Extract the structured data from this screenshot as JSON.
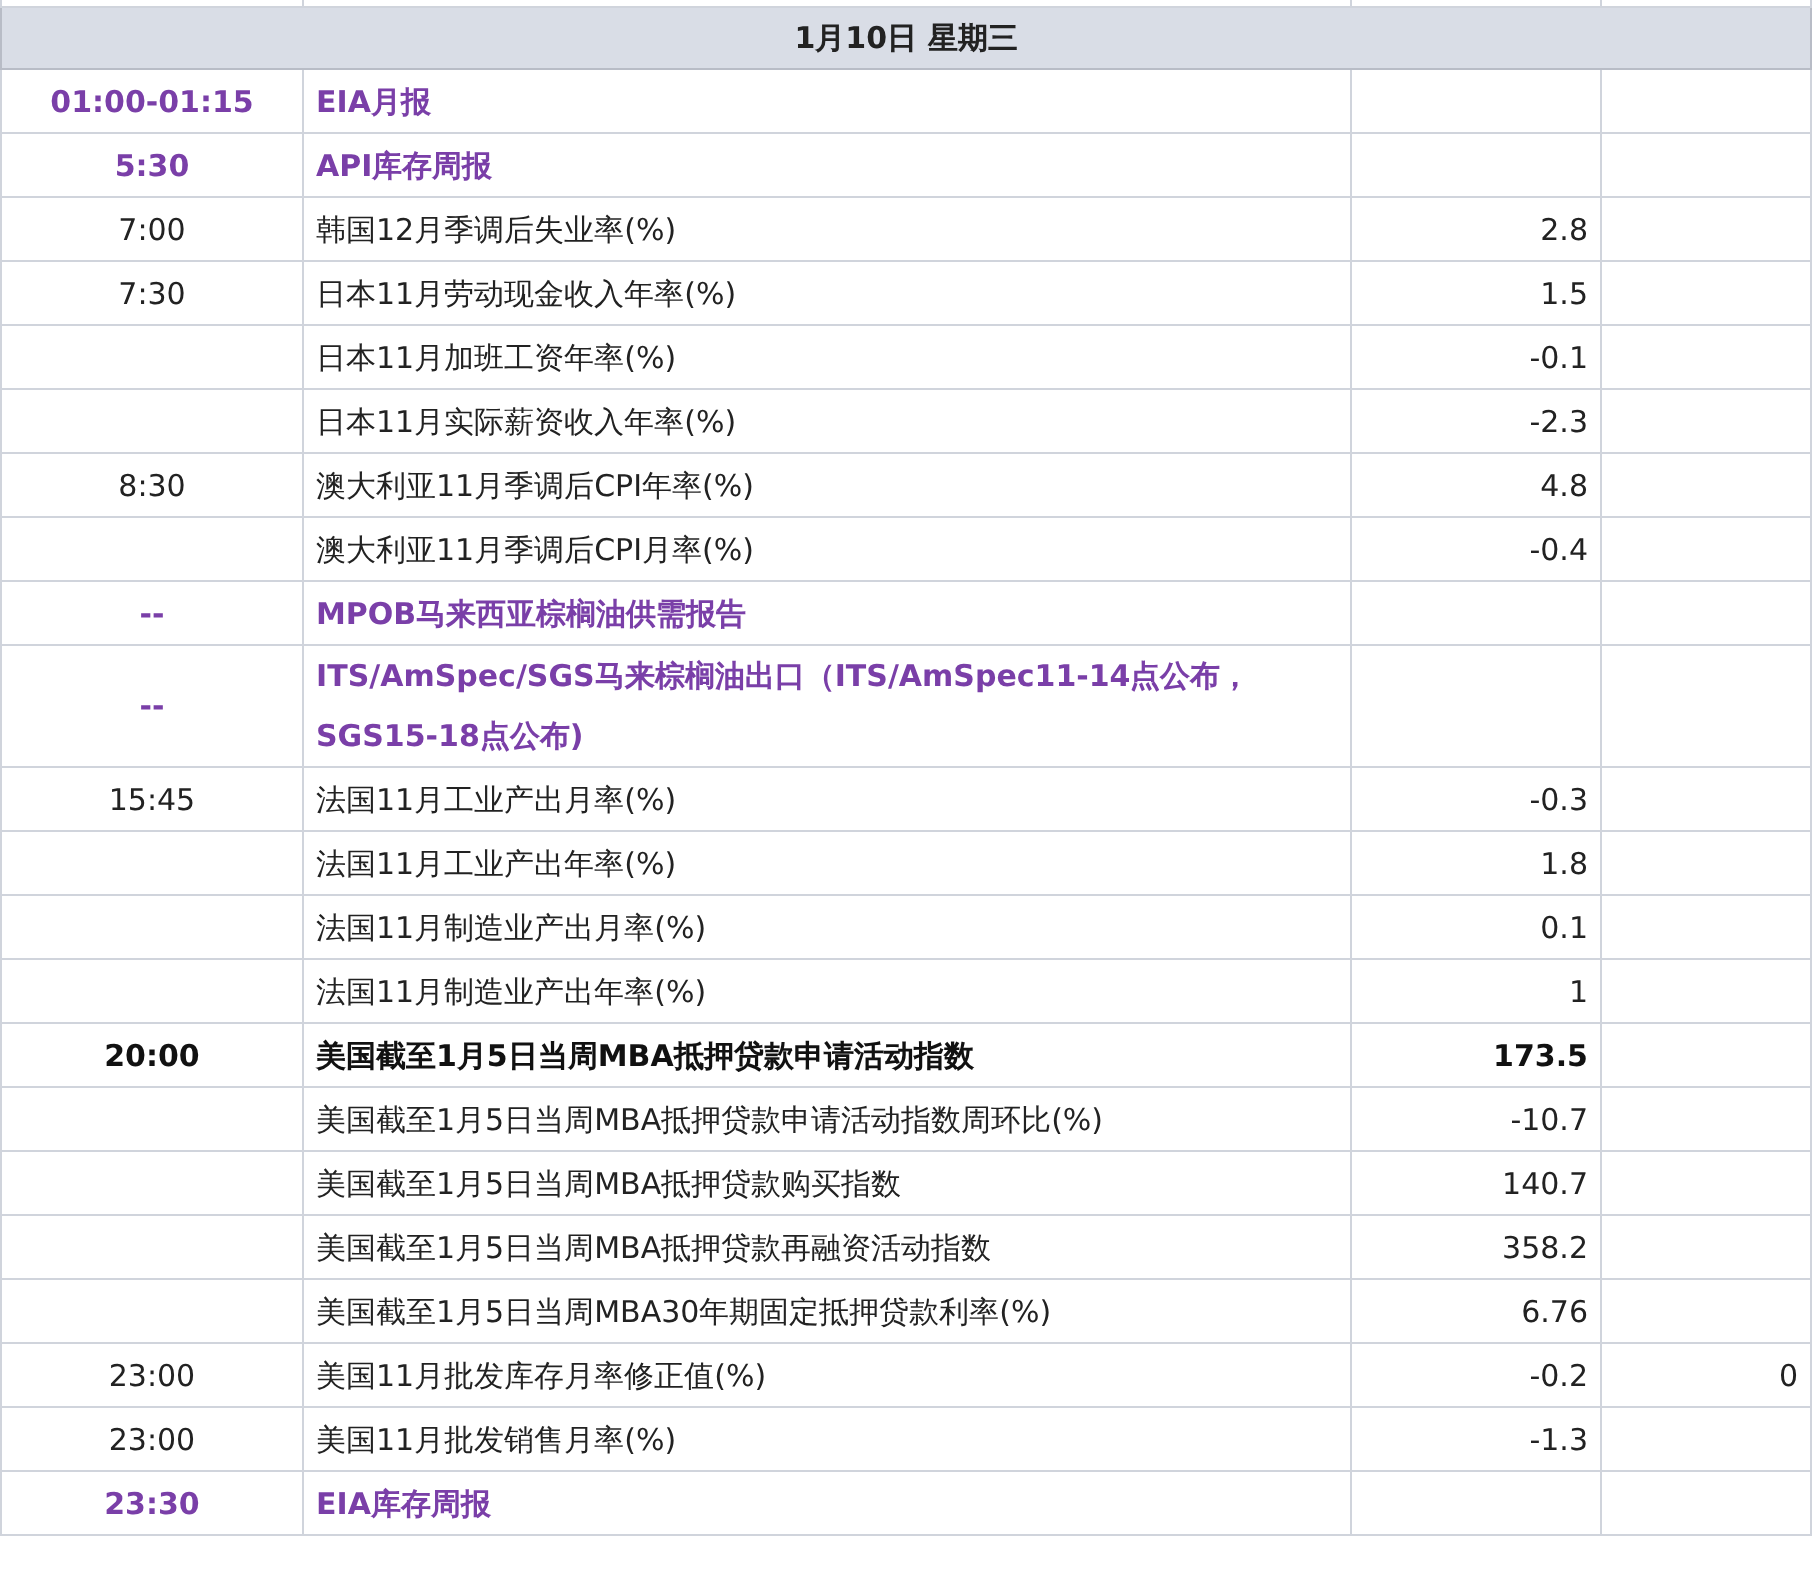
{
  "day_header": "1月10日 星期三",
  "rows": [
    {
      "time": "01:00-01:15",
      "kind": "event",
      "title": "EIA月报"
    },
    {
      "time": "5:30",
      "kind": "event",
      "title": "API库存周报"
    },
    {
      "time": "7:00",
      "kind": "data",
      "title": "韩国12月季调后失业率(%)",
      "value": "2.8"
    },
    {
      "time": "7:30",
      "kind": "data",
      "title": "日本11月劳动现金收入年率(%)",
      "value": "1.5"
    },
    {
      "kind": "data",
      "title": "日本11月加班工资年率(%)",
      "value": "-0.1"
    },
    {
      "kind": "data",
      "title": "日本11月实际薪资收入年率(%)",
      "value": "-2.3"
    },
    {
      "time": "8:30",
      "kind": "data",
      "title": "澳大利亚11月季调后CPI年率(%)",
      "value": "4.8"
    },
    {
      "kind": "data",
      "title": "澳大利亚11月季调后CPI月率(%)",
      "value": "-0.4"
    },
    {
      "time": "--",
      "kind": "event",
      "title": "MPOB马来西亚棕榈油供需报告"
    },
    {
      "time": "--",
      "kind": "event",
      "title": "ITS/AmSpec/SGS马来棕榈油出口（ITS/AmSpec11-14点公布，SGS15-18点公布)"
    },
    {
      "time": "15:45",
      "kind": "data",
      "title": "法国11月工业产出月率(%)",
      "value": "-0.3"
    },
    {
      "kind": "data",
      "title": "法国11月工业产出年率(%)",
      "value": "1.8"
    },
    {
      "kind": "data",
      "title": "法国11月制造业产出月率(%)",
      "value": "0.1"
    },
    {
      "kind": "data",
      "title": "法国11月制造业产出年率(%)",
      "value": "1"
    },
    {
      "time": "20:00",
      "kind": "key",
      "title": "美国截至1月5日当周MBA抵押贷款申请活动指数",
      "value": "173.5"
    },
    {
      "kind": "data",
      "title": "美国截至1月5日当周MBA抵押贷款申请活动指数周环比(%)",
      "value": "-10.7"
    },
    {
      "kind": "data",
      "title": "美国截至1月5日当周MBA抵押贷款购买指数",
      "value": "140.7"
    },
    {
      "kind": "data",
      "title": "美国截至1月5日当周MBA抵押贷款再融资活动指数",
      "value": "358.2"
    },
    {
      "kind": "data",
      "title": "美国截至1月5日当周MBA30年期固定抵押贷款利率(%)",
      "value": "6.76"
    },
    {
      "time": "23:00",
      "kind": "data",
      "title": "美国11月批发库存月率修正值(%)",
      "value": "-0.2",
      "column_4": "0"
    },
    {
      "time": "23:00",
      "kind": "data",
      "title": "美国11月批发销售月率(%)",
      "value": "-1.3"
    },
    {
      "time": "23:30",
      "kind": "event",
      "title": "EIA库存周报"
    }
  ]
}
